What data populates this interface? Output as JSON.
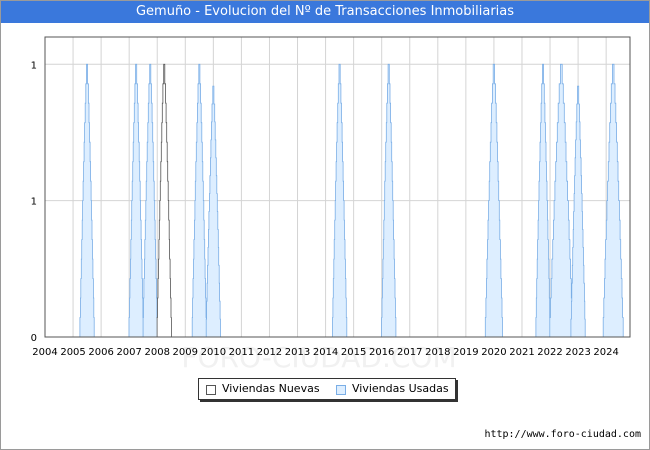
{
  "title": "Gemuño - Evolucion del Nº de Transacciones Inmobiliarias",
  "footer": "http://www.foro-ciudad.com",
  "watermark": "FORO-CIUDAD.COM",
  "legend": {
    "nuevas": "Viviendas Nuevas",
    "usadas": "Viviendas Usadas"
  },
  "colors": {
    "title_bg": "#3a78dc",
    "usadas_fill": "#ddeeff",
    "usadas_line": "#7aaee6",
    "nuevas_fill": "#ffffff",
    "nuevas_line": "#555555",
    "grid": "#d4d4d4"
  },
  "chart_data": {
    "type": "area",
    "x_ticks": [
      "2004",
      "2005",
      "2006",
      "2007",
      "2008",
      "2009",
      "2010",
      "2011",
      "2012",
      "2013",
      "2014",
      "2015",
      "2016",
      "2017",
      "2018",
      "2019",
      "2020",
      "2021",
      "2022",
      "2023",
      "2024"
    ],
    "y_tick_labels": [
      "0",
      "1",
      "1"
    ],
    "y_tick_values": [
      0,
      0.5,
      1
    ],
    "xlim": [
      2004,
      2024.85
    ],
    "ylim": [
      0,
      1.1
    ],
    "grid": true,
    "legend_position": "bottom-center",
    "series": [
      {
        "name": "Viviendas Nuevas",
        "peaks": [
          {
            "center": 2008.25,
            "half_width": 0.25,
            "value": 1
          }
        ]
      },
      {
        "name": "Viviendas Usadas",
        "peaks": [
          {
            "center": 2005.5,
            "half_width": 0.25,
            "value": 1
          },
          {
            "center": 2007.25,
            "half_width": 0.25,
            "value": 1
          },
          {
            "center": 2007.75,
            "half_width": 0.25,
            "value": 1
          },
          {
            "center": 2009.5,
            "half_width": 0.25,
            "value": 1
          },
          {
            "center": 2010.0,
            "half_width": 0.25,
            "value": 0.92
          },
          {
            "center": 2014.5,
            "half_width": 0.25,
            "value": 1
          },
          {
            "center": 2016.25,
            "half_width": 0.25,
            "value": 1
          },
          {
            "center": 2020.0,
            "half_width": 0.3,
            "value": 1
          },
          {
            "center": 2021.75,
            "half_width": 0.25,
            "value": 1
          },
          {
            "center": 2022.4,
            "half_width": 0.4,
            "value": 1
          },
          {
            "center": 2023.0,
            "half_width": 0.25,
            "value": 0.92
          },
          {
            "center": 2024.25,
            "half_width": 0.35,
            "value": 1
          }
        ]
      }
    ]
  }
}
